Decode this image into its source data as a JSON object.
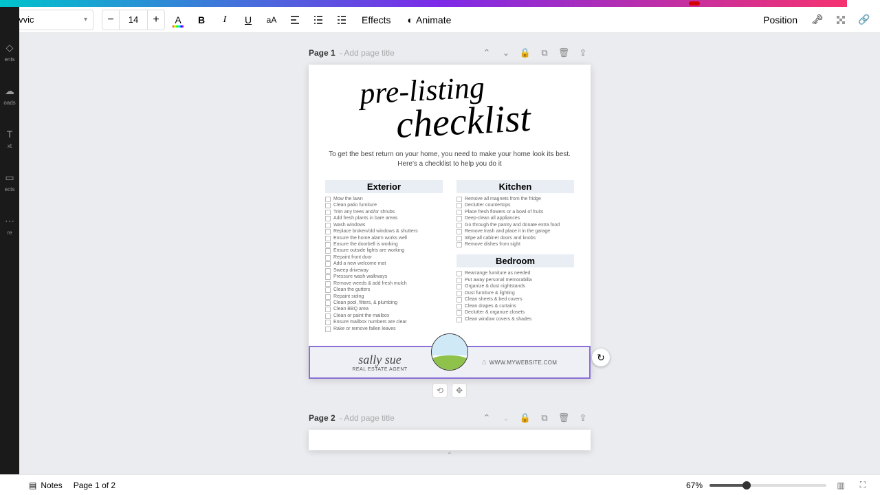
{
  "toolbar": {
    "font_name": "Livvic",
    "font_size": "14",
    "effects_label": "Effects",
    "animate_label": "Animate",
    "position_label": "Position"
  },
  "left_rail": {
    "items": [
      "ents",
      "oads",
      "xt",
      "ects",
      "re"
    ]
  },
  "page1": {
    "label": "Page 1",
    "title_hint": " - Add page title"
  },
  "page2": {
    "label": "Page 2",
    "title_hint": " - Add page title"
  },
  "doc": {
    "title_line1": "pre-listing",
    "title_line2": "checklist",
    "intro": "To get the best return on your home, you need to make your home look its best. Here's a checklist to help you do it",
    "exterior_head": "Exterior",
    "kitchen_head": "Kitchen",
    "bedroom_head": "Bedroom",
    "exterior_items": [
      "Mow the lawn",
      "Clean patio furniture",
      "Trim any trees and/or shrubs",
      "Add fresh plants in bare areas",
      "Wash windows",
      "Replace broken/old windows & shutters",
      "Ensure the home alarm works well",
      "Ensure the doorbell is working",
      "Ensure outside lights are working",
      "Repaint front door",
      "Add a new welcome mat",
      "Sweep driveway",
      "Pressure wash walkways",
      "Remove weeds & add fresh mulch",
      "Clean the gutters",
      "Repaint siding",
      "Clean pool, filters, & plumbing",
      "Clean BBQ area",
      "Clean or paint the mailbox",
      "Ensure mailbox numbers are clear",
      "Rake or remove fallen leaves"
    ],
    "kitchen_items": [
      "Remove all magnets from the fridge",
      "Declutter countertops",
      "Place fresh flowers or a bowl of fruits",
      "Deep-clean all appliances",
      "Go through the pantry and donate extra food",
      "Remove trash and place it in the garage",
      "Wipe all cabinet doors and knobs",
      "Remove dishes from sight"
    ],
    "bedroom_items": [
      "Rearrange furniture as needed",
      "Put away personal memorabilia",
      "Organize & dust nightstands",
      "Dust furniture & lighting",
      "Clean sheets & bed covers",
      "Clean drapes & curtains",
      "Declutter & organize closets",
      "Clean window covers & shades"
    ],
    "agent_name": "sally sue",
    "agent_role": "REAL ESTATE AGENT",
    "website": "WWW.MYWEBSITE.COM"
  },
  "bottom": {
    "notes_label": "Notes",
    "page_indicator": "Page 1 of 2",
    "zoom_label": "67%"
  }
}
